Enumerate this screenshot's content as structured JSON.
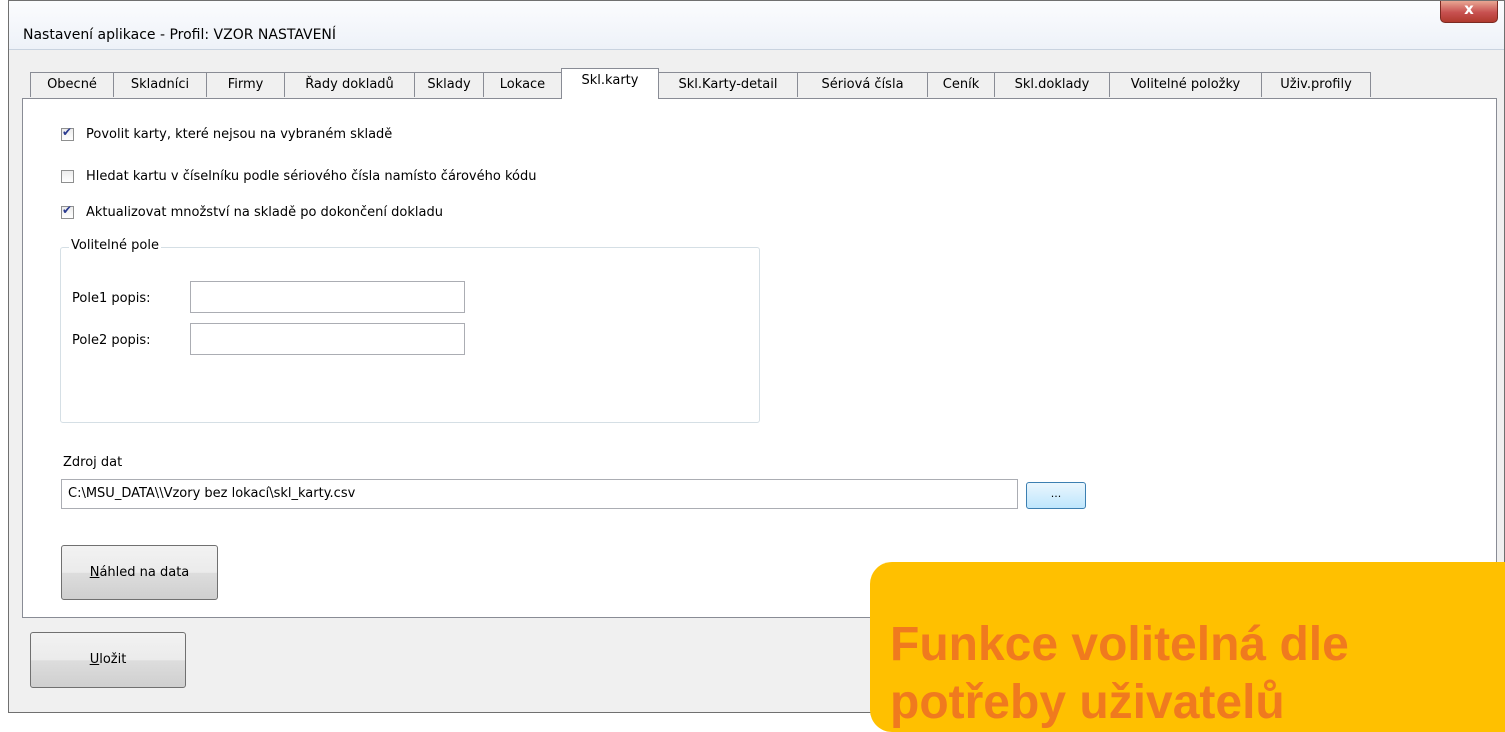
{
  "window": {
    "title": "Nastavení aplikace - Profil: VZOR NASTAVENÍ",
    "close_glyph": "x"
  },
  "tabs": [
    {
      "label": "Obecné"
    },
    {
      "label": "Skladníci"
    },
    {
      "label": "Firmy"
    },
    {
      "label": "Řady dokladů"
    },
    {
      "label": "Sklady"
    },
    {
      "label": "Lokace"
    },
    {
      "label": "Skl.karty",
      "active": true
    },
    {
      "label": "Skl.Karty-detail"
    },
    {
      "label": "Sériová čísla"
    },
    {
      "label": "Ceník"
    },
    {
      "label": "Skl.doklady"
    },
    {
      "label": "Volitelné položky"
    },
    {
      "label": "Uživ.profily"
    }
  ],
  "options": [
    {
      "label": "Povolit karty, které nejsou na vybraném skladě",
      "checked": true
    },
    {
      "label": "Hledat kartu v číselníku podle sériového čísla namísto čárového kódu",
      "checked": false
    },
    {
      "label": "Aktualizovat množství na skladě po dokončení dokladu",
      "checked": true
    }
  ],
  "volitelne_pole": {
    "legend": "Volitelné pole",
    "pole1_label": "Pole1 popis:",
    "pole1_value": "",
    "pole2_label": "Pole2 popis:",
    "pole2_value": ""
  },
  "zdroj_dat": {
    "label": "Zdroj dat",
    "path": "C:\\MSU_DATA\\\\Vzory bez lokací\\skl_karty.csv",
    "browse_label": "..."
  },
  "buttons": {
    "preview_mnemonic": "N",
    "preview_rest": "áhled na data",
    "save_mnemonic": "U",
    "save_rest": "ložit"
  },
  "callout": {
    "line1": "Funkce volitelná dle",
    "line2": "potřeby uživatelů"
  },
  "colors": {
    "callout_bg": "#ffc000",
    "callout_text": "#f07a1e",
    "close_button": "#c75050"
  }
}
